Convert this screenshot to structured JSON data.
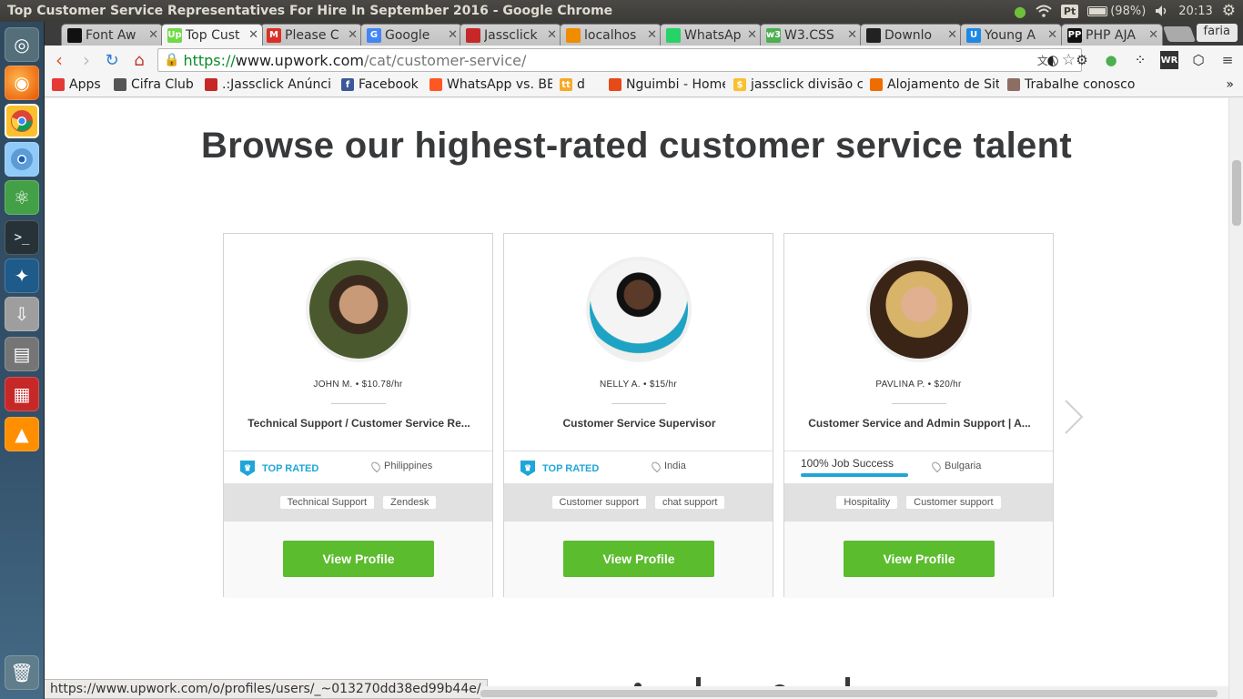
{
  "os": {
    "window_title": "Top Customer Service Representatives For Hire In September 2016 - Google Chrome",
    "keyboard_layout": "Pt",
    "battery": "(98%)",
    "clock": "20:13"
  },
  "browser": {
    "profile": "faria",
    "tabs": [
      {
        "label": "Font Aw",
        "fav_color": "#111"
      },
      {
        "label": "Top Cust",
        "fav_color": "#6fda44",
        "fav_text": "Up"
      },
      {
        "label": "Please C",
        "fav_color": "#d93025",
        "fav_text": "M"
      },
      {
        "label": "Google",
        "fav_color": "#4285f4",
        "fav_text": "G"
      },
      {
        "label": "Jassclick",
        "fav_color": "#c62828"
      },
      {
        "label": "localhos",
        "fav_color": "#f08c00"
      },
      {
        "label": "WhatsAp",
        "fav_color": "#25d366"
      },
      {
        "label": "W3.CSS",
        "fav_color": "#4caf50",
        "fav_text": "w3"
      },
      {
        "label": "Downlo",
        "fav_color": "#222"
      },
      {
        "label": "Young A",
        "fav_color": "#1e88e5",
        "fav_text": "U"
      },
      {
        "label": "PHP AJA",
        "fav_color": "#111",
        "fav_text": "PP"
      }
    ],
    "url": {
      "scheme": "https://",
      "host": "www.upwork.com",
      "path": "/cat/customer-service/"
    },
    "bookmarks": [
      {
        "label": "Apps",
        "color": "#e53935"
      },
      {
        "label": "Cifra Club",
        "color": "#555"
      },
      {
        "label": ".:Jassclick Anúnci",
        "color": "#c62828"
      },
      {
        "label": "Facebook",
        "color": "#3b5998",
        "icon_text": "f"
      },
      {
        "label": "WhatsApp vs. BB",
        "color": "#ff5722"
      },
      {
        "label": "d",
        "color": "#f9a825",
        "icon_text": "tt"
      },
      {
        "label": "Nguimbi - Home",
        "color": "#e64a19"
      },
      {
        "label": "jassclick divisão c",
        "color": "#fbc02d",
        "icon_text": "$"
      },
      {
        "label": "Alojamento de Sit",
        "color": "#ef6c00"
      },
      {
        "label": "Trabalhe conosco",
        "color": "#8d6e63"
      }
    ],
    "status_url": "https://www.upwork.com/o/profiles/users/_~013270dd38ed99b44e/"
  },
  "page": {
    "headline": "Browse our highest-rated customer service talent",
    "view_profile_label": "View Profile",
    "top_rated_label": "TOP RATED",
    "freelancers": [
      {
        "name": "JOHN M.",
        "rate": "$10.78/hr",
        "title": "Technical Support / Customer Service Re...",
        "location": "Philippines",
        "badge": "TOP RATED",
        "skills": [
          "Technical Support",
          "Zendesk"
        ]
      },
      {
        "name": "NELLY A.",
        "rate": "$15/hr",
        "title": "Customer Service Supervisor",
        "location": "India",
        "badge": "TOP RATED",
        "skills": [
          "Customer support",
          "chat support"
        ]
      },
      {
        "name": "PAVLINA P.",
        "rate": "$20/hr",
        "title": "Customer Service and Admin Support | A...",
        "location": "Bulgaria",
        "job_success": "100% Job Success",
        "skills": [
          "Hospitality",
          "Customer support"
        ]
      }
    ]
  },
  "colors": {
    "upwork_green": "#5bbc2e",
    "top_rated_blue": "#1fa5d8",
    "heading": "#37393b"
  }
}
